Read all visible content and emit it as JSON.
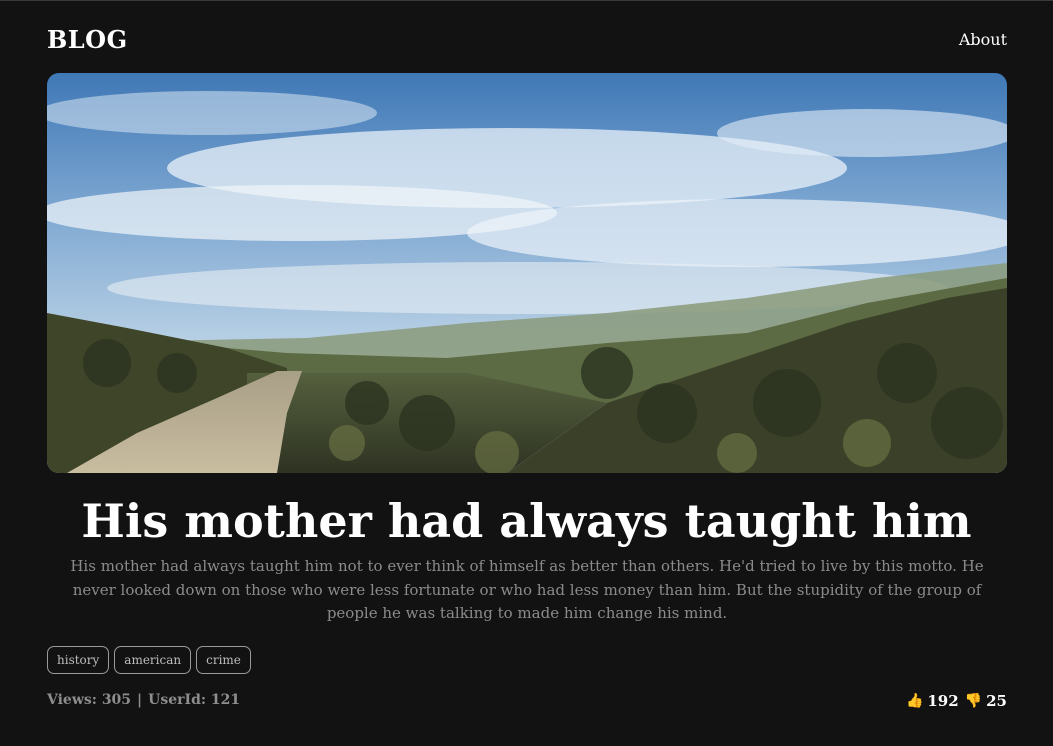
{
  "header": {
    "logo": "BLOG",
    "nav": {
      "about_label": "About"
    }
  },
  "post": {
    "image_alt": "Dirt road through green hills under a cloudy blue sky",
    "title": "His mother had always taught him",
    "body": "His mother had always taught him not to ever think of himself as better than others. He'd tried to live by this motto. He never looked down on those who were less fortunate or who had less money than him. But the stupidity of the group of people he was talking to made him change his mind.",
    "tags": [
      "history",
      "american",
      "crime"
    ],
    "views_label": "Views: 305",
    "separator": "|",
    "user_label": "UserId: 121",
    "reactions": {
      "likes": "192",
      "dislikes": "25",
      "like_icon": "thumbs-up-icon",
      "dislike_icon": "thumbs-down-icon",
      "icon_color": "#f2b233"
    }
  }
}
